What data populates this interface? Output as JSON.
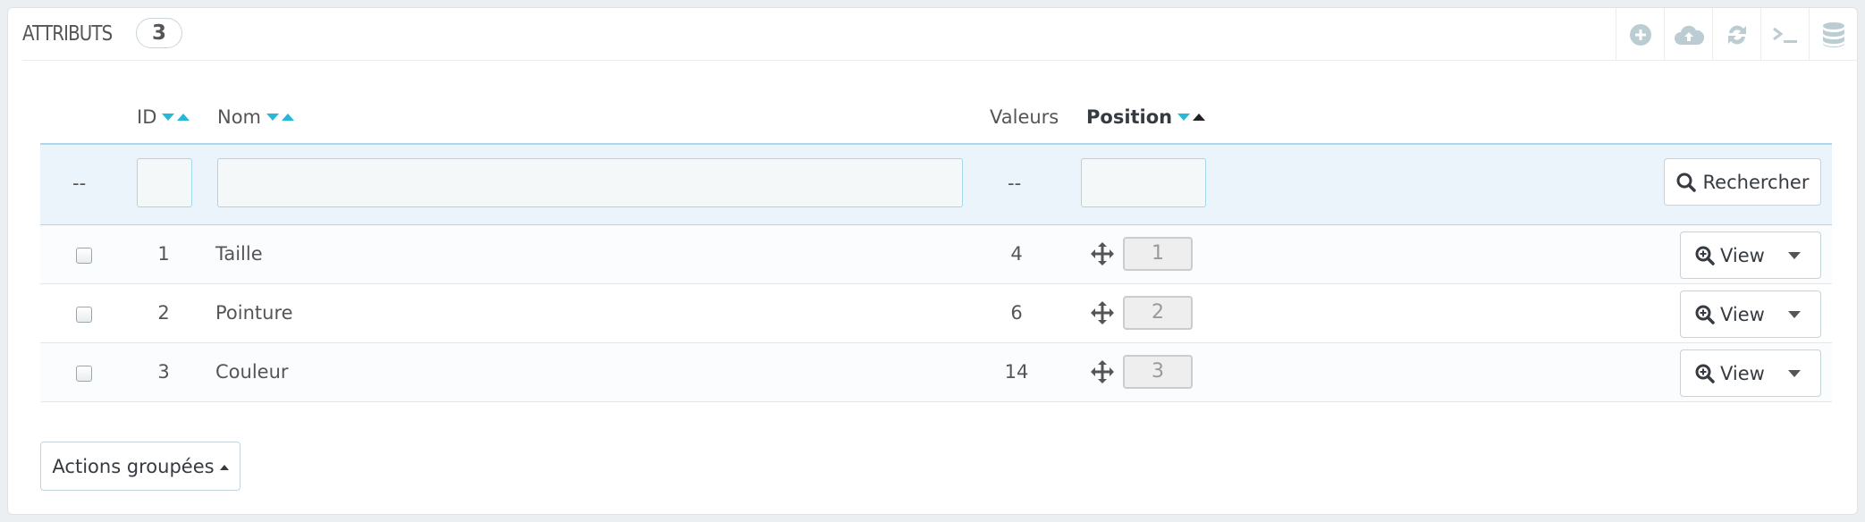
{
  "header": {
    "title": "ATTRIBUTS",
    "count": "3"
  },
  "toolbar": {
    "icons": [
      "add-icon",
      "cloud-upload-icon",
      "refresh-icon",
      "terminal-icon",
      "database-icon"
    ]
  },
  "columns": {
    "id": "ID",
    "name": "Nom",
    "values": "Valeurs",
    "position": "Position"
  },
  "filters": {
    "dash_select": "--",
    "dash_values": "--",
    "search_label": "Rechercher"
  },
  "rows": [
    {
      "id": "1",
      "name": "Taille",
      "values": "4",
      "position": "1",
      "action": "View"
    },
    {
      "id": "2",
      "name": "Pointure",
      "values": "6",
      "position": "2",
      "action": "View"
    },
    {
      "id": "3",
      "name": "Couleur",
      "values": "14",
      "position": "3",
      "action": "View"
    }
  ],
  "footer": {
    "bulk_label": "Actions groupées"
  },
  "colors": {
    "accent": "#25b9d7",
    "filter_bg": "#eaf4fa"
  }
}
